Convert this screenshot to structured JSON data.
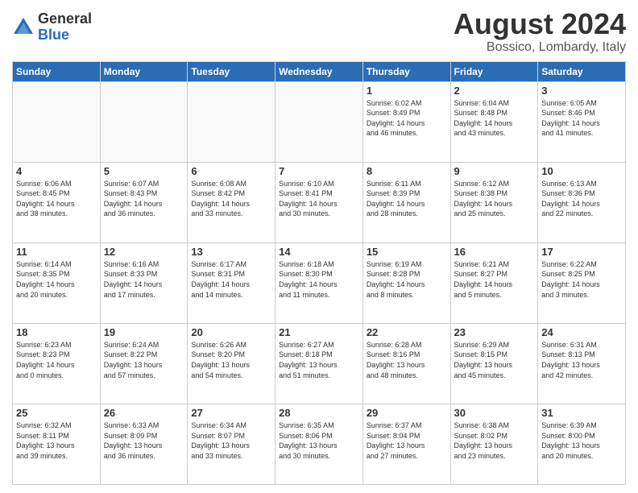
{
  "logo": {
    "general": "General",
    "blue": "Blue"
  },
  "header": {
    "month": "August 2024",
    "location": "Bossico, Lombardy, Italy"
  },
  "weekdays": [
    "Sunday",
    "Monday",
    "Tuesday",
    "Wednesday",
    "Thursday",
    "Friday",
    "Saturday"
  ],
  "weeks": [
    [
      {
        "day": "",
        "info": ""
      },
      {
        "day": "",
        "info": ""
      },
      {
        "day": "",
        "info": ""
      },
      {
        "day": "",
        "info": ""
      },
      {
        "day": "1",
        "info": "Sunrise: 6:02 AM\nSunset: 8:49 PM\nDaylight: 14 hours\nand 46 minutes."
      },
      {
        "day": "2",
        "info": "Sunrise: 6:04 AM\nSunset: 8:48 PM\nDaylight: 14 hours\nand 43 minutes."
      },
      {
        "day": "3",
        "info": "Sunrise: 6:05 AM\nSunset: 8:46 PM\nDaylight: 14 hours\nand 41 minutes."
      }
    ],
    [
      {
        "day": "4",
        "info": "Sunrise: 6:06 AM\nSunset: 8:45 PM\nDaylight: 14 hours\nand 38 minutes."
      },
      {
        "day": "5",
        "info": "Sunrise: 6:07 AM\nSunset: 8:43 PM\nDaylight: 14 hours\nand 36 minutes."
      },
      {
        "day": "6",
        "info": "Sunrise: 6:08 AM\nSunset: 8:42 PM\nDaylight: 14 hours\nand 33 minutes."
      },
      {
        "day": "7",
        "info": "Sunrise: 6:10 AM\nSunset: 8:41 PM\nDaylight: 14 hours\nand 30 minutes."
      },
      {
        "day": "8",
        "info": "Sunrise: 6:11 AM\nSunset: 8:39 PM\nDaylight: 14 hours\nand 28 minutes."
      },
      {
        "day": "9",
        "info": "Sunrise: 6:12 AM\nSunset: 8:38 PM\nDaylight: 14 hours\nand 25 minutes."
      },
      {
        "day": "10",
        "info": "Sunrise: 6:13 AM\nSunset: 8:36 PM\nDaylight: 14 hours\nand 22 minutes."
      }
    ],
    [
      {
        "day": "11",
        "info": "Sunrise: 6:14 AM\nSunset: 8:35 PM\nDaylight: 14 hours\nand 20 minutes."
      },
      {
        "day": "12",
        "info": "Sunrise: 6:16 AM\nSunset: 8:33 PM\nDaylight: 14 hours\nand 17 minutes."
      },
      {
        "day": "13",
        "info": "Sunrise: 6:17 AM\nSunset: 8:31 PM\nDaylight: 14 hours\nand 14 minutes."
      },
      {
        "day": "14",
        "info": "Sunrise: 6:18 AM\nSunset: 8:30 PM\nDaylight: 14 hours\nand 11 minutes."
      },
      {
        "day": "15",
        "info": "Sunrise: 6:19 AM\nSunset: 8:28 PM\nDaylight: 14 hours\nand 8 minutes."
      },
      {
        "day": "16",
        "info": "Sunrise: 6:21 AM\nSunset: 8:27 PM\nDaylight: 14 hours\nand 5 minutes."
      },
      {
        "day": "17",
        "info": "Sunrise: 6:22 AM\nSunset: 8:25 PM\nDaylight: 14 hours\nand 3 minutes."
      }
    ],
    [
      {
        "day": "18",
        "info": "Sunrise: 6:23 AM\nSunset: 8:23 PM\nDaylight: 14 hours\nand 0 minutes."
      },
      {
        "day": "19",
        "info": "Sunrise: 6:24 AM\nSunset: 8:22 PM\nDaylight: 13 hours\nand 57 minutes."
      },
      {
        "day": "20",
        "info": "Sunrise: 6:26 AM\nSunset: 8:20 PM\nDaylight: 13 hours\nand 54 minutes."
      },
      {
        "day": "21",
        "info": "Sunrise: 6:27 AM\nSunset: 8:18 PM\nDaylight: 13 hours\nand 51 minutes."
      },
      {
        "day": "22",
        "info": "Sunrise: 6:28 AM\nSunset: 8:16 PM\nDaylight: 13 hours\nand 48 minutes."
      },
      {
        "day": "23",
        "info": "Sunrise: 6:29 AM\nSunset: 8:15 PM\nDaylight: 13 hours\nand 45 minutes."
      },
      {
        "day": "24",
        "info": "Sunrise: 6:31 AM\nSunset: 8:13 PM\nDaylight: 13 hours\nand 42 minutes."
      }
    ],
    [
      {
        "day": "25",
        "info": "Sunrise: 6:32 AM\nSunset: 8:11 PM\nDaylight: 13 hours\nand 39 minutes."
      },
      {
        "day": "26",
        "info": "Sunrise: 6:33 AM\nSunset: 8:09 PM\nDaylight: 13 hours\nand 36 minutes."
      },
      {
        "day": "27",
        "info": "Sunrise: 6:34 AM\nSunset: 8:07 PM\nDaylight: 13 hours\nand 33 minutes."
      },
      {
        "day": "28",
        "info": "Sunrise: 6:35 AM\nSunset: 8:06 PM\nDaylight: 13 hours\nand 30 minutes."
      },
      {
        "day": "29",
        "info": "Sunrise: 6:37 AM\nSunset: 8:04 PM\nDaylight: 13 hours\nand 27 minutes."
      },
      {
        "day": "30",
        "info": "Sunrise: 6:38 AM\nSunset: 8:02 PM\nDaylight: 13 hours\nand 23 minutes."
      },
      {
        "day": "31",
        "info": "Sunrise: 6:39 AM\nSunset: 8:00 PM\nDaylight: 13 hours\nand 20 minutes."
      }
    ]
  ]
}
